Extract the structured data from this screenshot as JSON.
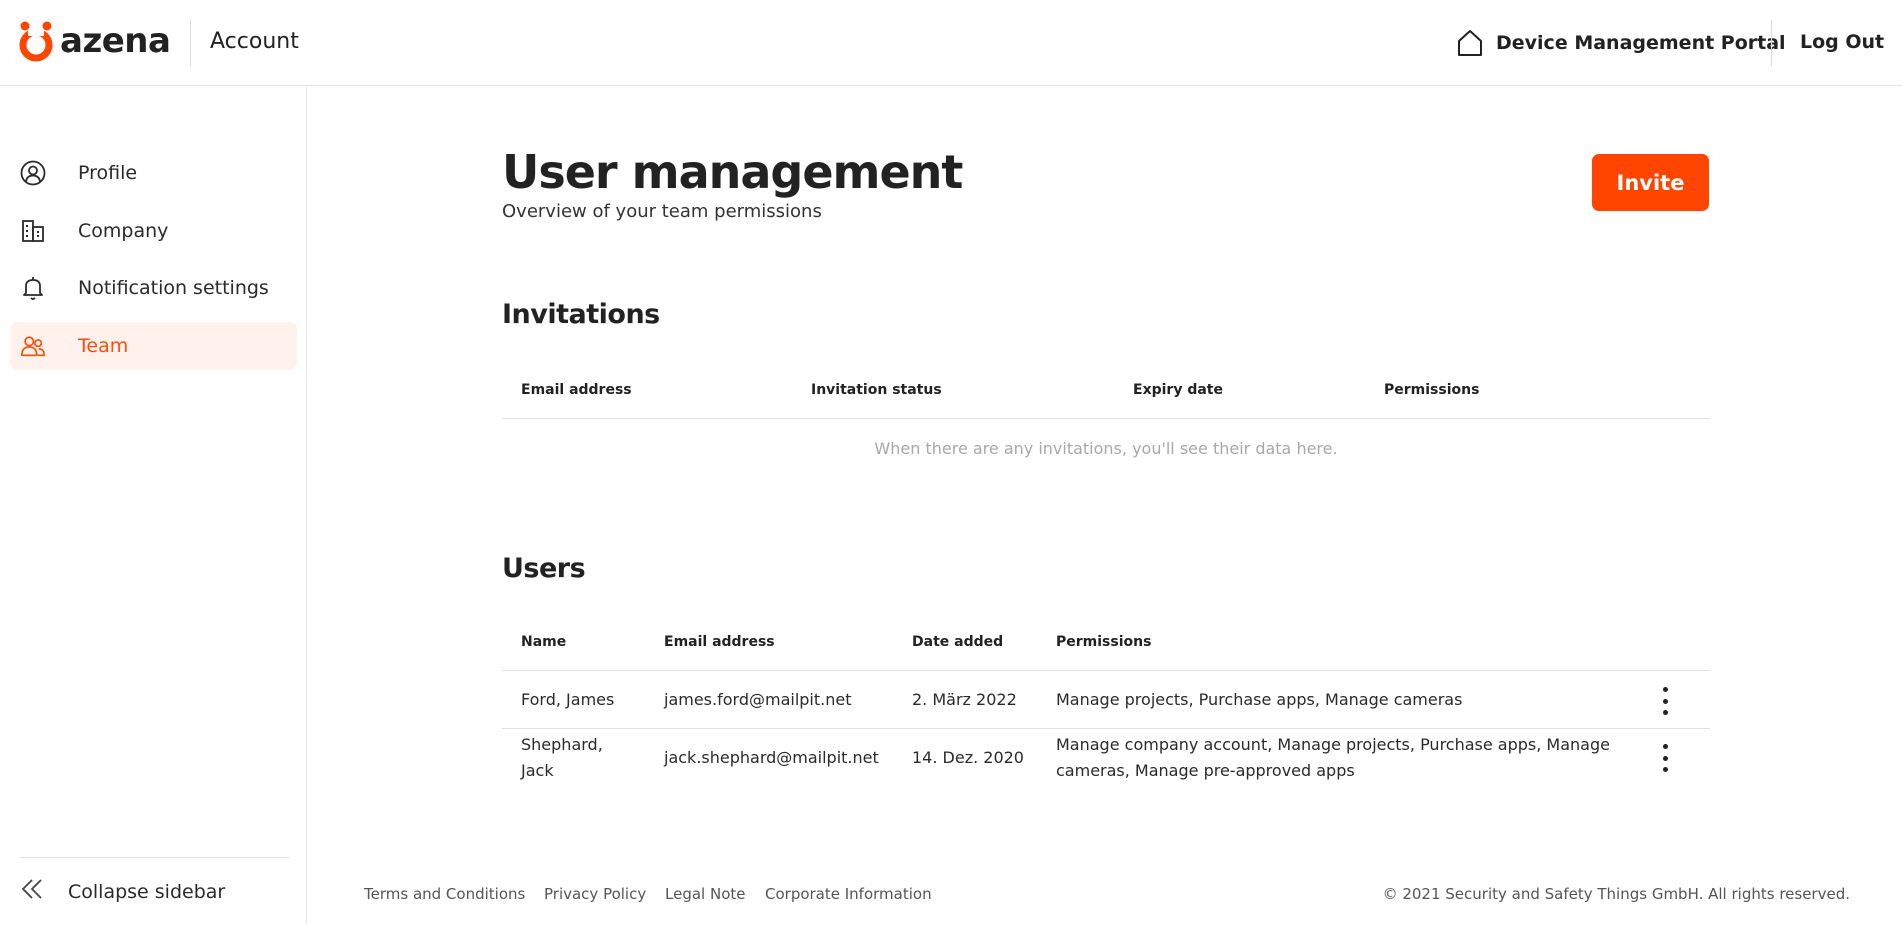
{
  "header": {
    "logo_text": "azena",
    "section": "Account",
    "portal_link": "Device Management Portal",
    "logout": "Log Out"
  },
  "sidebar": {
    "items": [
      {
        "label": "Profile",
        "icon": "user-circle-icon"
      },
      {
        "label": "Company",
        "icon": "building-icon"
      },
      {
        "label": "Notification settings",
        "icon": "bell-icon"
      },
      {
        "label": "Team",
        "icon": "team-icon",
        "active": true
      }
    ],
    "collapse_label": "Collapse sidebar"
  },
  "main": {
    "title": "User management",
    "subtitle": "Overview of your team permissions",
    "invite_label": "Invite",
    "invitations": {
      "title": "Invitations",
      "columns": [
        "Email address",
        "Invitation status",
        "Expiry date",
        "Permissions"
      ],
      "empty_message": "When there are any invitations, you'll see their data here."
    },
    "users": {
      "title": "Users",
      "columns": [
        "Name",
        "Email address",
        "Date added",
        "Permissions"
      ],
      "rows": [
        {
          "name": "Ford, James",
          "email": "james.ford@mailpit.net",
          "date_added": "2. März 2022",
          "permissions": "Manage projects, Purchase apps, Manage cameras"
        },
        {
          "name": "Shephard, Jack",
          "email": "jack.shephard@mailpit.net",
          "date_added": "14. Dez. 2020",
          "permissions": "Manage company account, Manage projects, Purchase apps, Manage cameras, Manage pre-approved apps"
        }
      ]
    }
  },
  "footer": {
    "links": [
      "Terms and Conditions",
      "Privacy Policy",
      "Legal Note",
      "Corporate Information"
    ],
    "copyright": "© 2021 Security and Safety Things GmbH. All rights reserved."
  },
  "colors": {
    "accent": "#ff4500",
    "active_bg": "#fff1ec"
  }
}
